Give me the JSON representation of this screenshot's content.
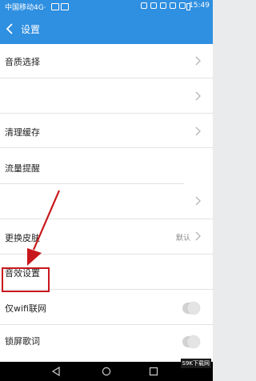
{
  "status_bar": {
    "carrier": "中国移动4G·",
    "time": "15:49"
  },
  "header": {
    "title": "设置"
  },
  "settings": {
    "items": [
      {
        "label": "音质选择",
        "control": "chevron"
      },
      {
        "label": "",
        "control": "chevron"
      },
      {
        "label": "清理缓存",
        "control": "chevron"
      },
      {
        "label": "流量提醒",
        "control": "none"
      },
      {
        "label": "",
        "control": "chevron"
      },
      {
        "label": "更换皮肤",
        "control": "value-chevron",
        "value": "默认"
      },
      {
        "label": "音效设置",
        "control": "none",
        "highlighted": true
      },
      {
        "label": "仅wifi联网",
        "control": "toggle",
        "on": false
      },
      {
        "label": "锁屏歌词",
        "control": "toggle",
        "on": false
      }
    ]
  },
  "annotation": {
    "highlight_color": "#c8171c"
  },
  "watermark": {
    "text": "S9K下载网"
  },
  "theme": {
    "accent": "#2f8fe0",
    "background": "#e9ebec"
  }
}
